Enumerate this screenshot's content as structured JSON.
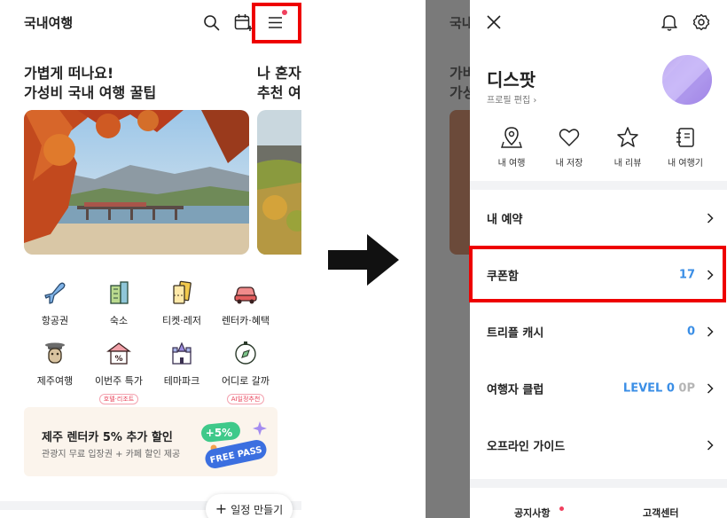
{
  "left": {
    "title": "국내여행",
    "promos": [
      {
        "title": "가볍게 떠나요!\n가성비 국내 여행 꿀팁"
      },
      {
        "title": "나 혼자\n추천 여"
      }
    ],
    "categories": [
      {
        "label": "항공권",
        "icon": "airplane-icon"
      },
      {
        "label": "숙소",
        "icon": "building-icon"
      },
      {
        "label": "티켓·레저",
        "icon": "ticket-icon"
      },
      {
        "label": "렌터카·혜택",
        "icon": "car-icon"
      },
      {
        "label": "제주여행",
        "icon": "jeju-icon"
      },
      {
        "label": "이번주 특가",
        "sub": "호텔·리조트",
        "icon": "discount-icon"
      },
      {
        "label": "테마파크",
        "icon": "castle-icon"
      },
      {
        "label": "어디로 갈까",
        "sub": "AI일정추천",
        "icon": "compass-icon"
      }
    ],
    "banner": {
      "title": "제주 렌터카 5% 추가 할인",
      "subtitle": "관광지 무료 입장권 + 카페 할인 제공",
      "badge": "+5%",
      "pass": "FREE PASS"
    },
    "fab_label": "일정 만들기"
  },
  "background": {
    "title": "국내여",
    "promo": "가벼\n가성"
  },
  "drawer": {
    "profile_name": "디스팟",
    "profile_edit": "프로필 편집",
    "quick_links": [
      {
        "label": "내 여행",
        "icon": "map-pin-icon"
      },
      {
        "label": "내 저장",
        "icon": "heart-icon"
      },
      {
        "label": "내 리뷰",
        "icon": "star-icon"
      },
      {
        "label": "내 여행기",
        "icon": "notebook-icon"
      }
    ],
    "menu": [
      {
        "label": "내 예약",
        "value": ""
      },
      {
        "label": "쿠폰함",
        "value": "17"
      },
      {
        "label": "트리플 캐시",
        "value": "0"
      },
      {
        "label": "여행자 클럽",
        "value": "LEVEL 0",
        "value_suffix": "0P"
      },
      {
        "label": "오프라인 가이드",
        "value": ""
      }
    ],
    "footer": {
      "notice": "공지사항",
      "support": "고객센터"
    }
  },
  "colors": {
    "accent_blue": "#3a8ee6",
    "highlight_red": "#ee0000",
    "dot_pink": "#f0405e"
  }
}
